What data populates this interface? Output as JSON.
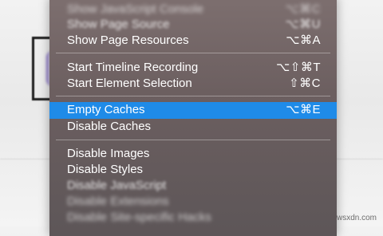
{
  "menu": {
    "items": [
      {
        "label": "Show JavaScript Console",
        "shortcut": "⌥⌘C"
      },
      {
        "label": "Show Page Source",
        "shortcut": "⌥⌘U"
      },
      {
        "label": "Show Page Resources",
        "shortcut": "⌥⌘A"
      },
      {
        "label": "Start Timeline Recording",
        "shortcut": "⌥⇧⌘T"
      },
      {
        "label": "Start Element Selection",
        "shortcut": "⇧⌘C"
      },
      {
        "label": "Empty Caches",
        "shortcut": "⌥⌘E"
      },
      {
        "label": "Disable Caches",
        "shortcut": ""
      },
      {
        "label": "Disable Images",
        "shortcut": ""
      },
      {
        "label": "Disable Styles",
        "shortcut": ""
      },
      {
        "label": "Disable JavaScript",
        "shortcut": ""
      },
      {
        "label": "Disable Extensions",
        "shortcut": ""
      },
      {
        "label": "Disable Site-specific Hacks",
        "shortcut": ""
      }
    ],
    "highlight_color": "#1f8be8",
    "background_color": "#6f6264"
  },
  "watermark": "wsxdn.com"
}
